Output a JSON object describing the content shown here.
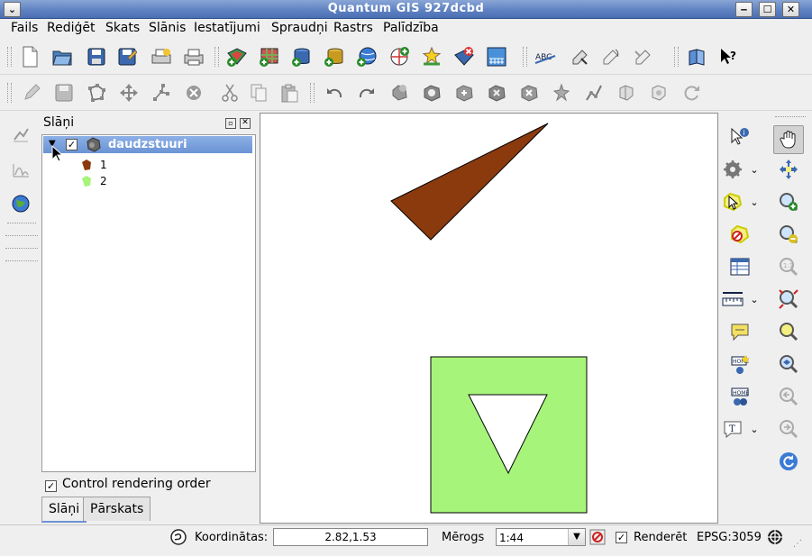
{
  "window": {
    "title": "Quantum GIS 927dcbd",
    "menu_glyph": "⌄",
    "min_glyph": "‒",
    "max_glyph": "☐",
    "close_glyph": "✕"
  },
  "menu": [
    "Fails",
    "Rediģēt",
    "Skats",
    "Slānis",
    "Iestatījumi",
    "Spraudņi",
    "Rastrs",
    "Palīdzība"
  ],
  "layers_panel": {
    "title": "Slāņi",
    "layer_name": "daudzstuuri",
    "layer_checked": true,
    "legend": [
      {
        "label": "1",
        "color": "#8B3A0E"
      },
      {
        "label": "2",
        "color": "#A6F57A"
      }
    ],
    "control_rendering_label": "Control rendering order",
    "control_rendering_checked": true,
    "tabs": [
      "Slāņi",
      "Pārskats"
    ],
    "active_tab": "Slāņi"
  },
  "map": {
    "features": [
      {
        "name": "1",
        "fill": "#8B3A0E"
      },
      {
        "name": "2",
        "fill": "#A6F57A"
      }
    ]
  },
  "statusbar": {
    "coord_label": "Koordinātas:",
    "coord_value": "2.82,1.53",
    "scale_label": "Mērogs",
    "scale_value": "1:44",
    "render_label": "Renderēt",
    "render_checked": true,
    "crs": "EPSG:3059"
  },
  "colors": {
    "selection": "#6b93d4",
    "titlebar": "#5f82c2"
  }
}
